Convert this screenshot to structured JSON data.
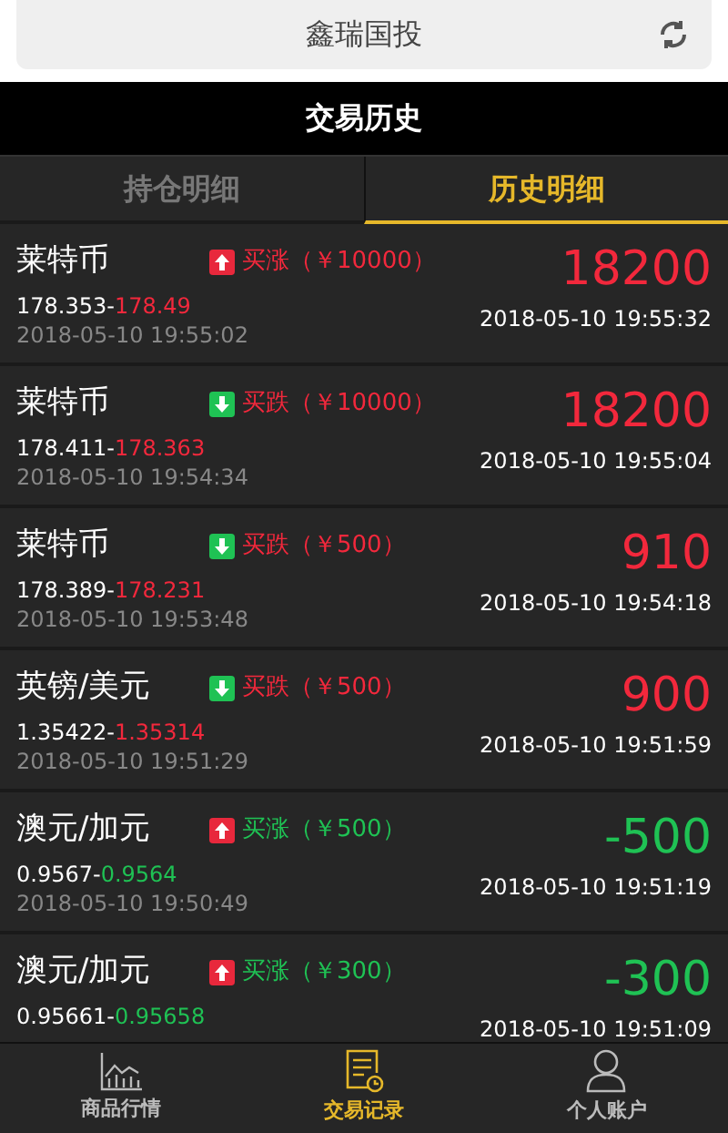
{
  "header": {
    "title": "鑫瑞国投"
  },
  "title_bar": {
    "title": "交易历史"
  },
  "tabs": [
    {
      "label": "持仓明细",
      "selected": false
    },
    {
      "label": "历史明细",
      "selected": true
    }
  ],
  "trades": [
    {
      "name": "莱特币",
      "kind": "up",
      "loss": false,
      "order": "买涨（￥10000）",
      "open_price": "178.353-",
      "close_price": "178.49",
      "open_time": "2018-05-10 19:55:02",
      "profit": "18200",
      "close_time": "2018-05-10 19:55:32"
    },
    {
      "name": "莱特币",
      "kind": "down",
      "loss": false,
      "order": "买跌（￥10000）",
      "open_price": "178.411-",
      "close_price": "178.363",
      "open_time": "2018-05-10 19:54:34",
      "profit": "18200",
      "close_time": "2018-05-10 19:55:04"
    },
    {
      "name": "莱特币",
      "kind": "down",
      "loss": false,
      "order": "买跌（￥500）",
      "open_price": "178.389-",
      "close_price": "178.231",
      "open_time": "2018-05-10 19:53:48",
      "profit": "910",
      "close_time": "2018-05-10 19:54:18"
    },
    {
      "name": "英镑/美元",
      "kind": "down",
      "loss": false,
      "order": "买跌（￥500）",
      "open_price": "1.35422-",
      "close_price": "1.35314",
      "open_time": "2018-05-10 19:51:29",
      "profit": "900",
      "close_time": "2018-05-10 19:51:59"
    },
    {
      "name": "澳元/加元",
      "kind": "up",
      "loss": true,
      "order": "买涨（￥500）",
      "open_price": "0.9567-",
      "close_price": "0.9564",
      "open_time": "2018-05-10 19:50:49",
      "profit": "-500",
      "close_time": "2018-05-10 19:51:19"
    },
    {
      "name": "澳元/加元",
      "kind": "up",
      "loss": true,
      "order": "买涨（￥300）",
      "open_price": "0.95661-",
      "close_price": "0.95658",
      "profit": "-300",
      "close_time": "2018-05-10 19:51:09"
    }
  ],
  "nav": [
    {
      "label": "商品行情",
      "kind": "chart",
      "selected": false
    },
    {
      "label": "交易记录",
      "kind": "record",
      "selected": true
    },
    {
      "label": "个人账户",
      "kind": "user",
      "selected": false
    }
  ]
}
